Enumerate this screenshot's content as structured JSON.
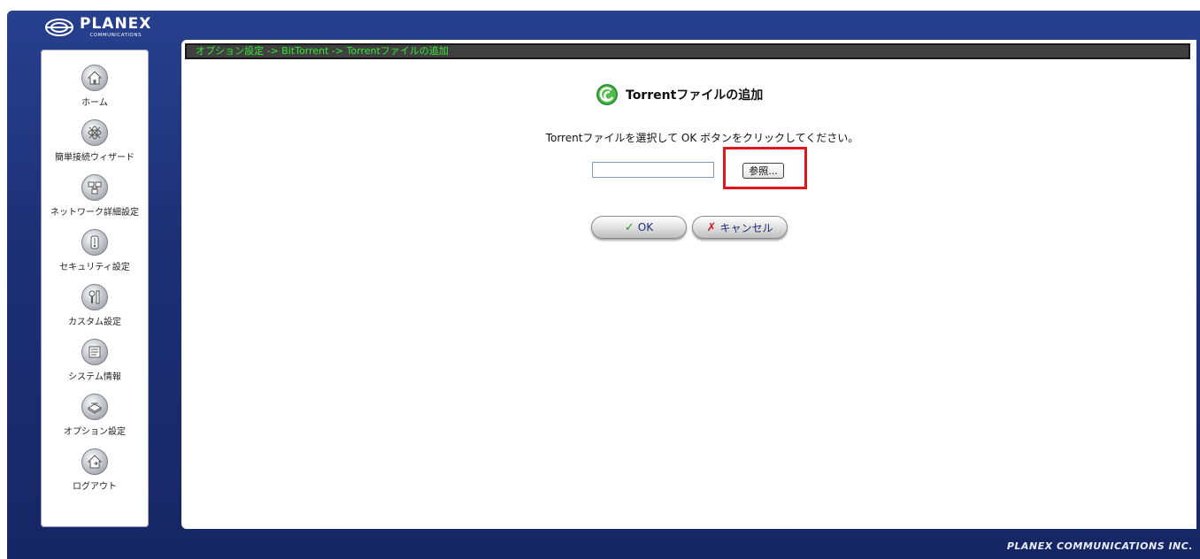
{
  "brand": {
    "name": "PLANEX",
    "subtitle": "COMMUNICATIONS",
    "footer": "PLANEX COMMUNICATIONS INC."
  },
  "sidebar": {
    "items": [
      {
        "label": "ホーム",
        "icon": "home-icon"
      },
      {
        "label": "簡単接続ウィザード",
        "icon": "wizard-icon"
      },
      {
        "label": "ネットワーク詳細設定",
        "icon": "network-icon"
      },
      {
        "label": "セキュリティ設定",
        "icon": "lock-icon"
      },
      {
        "label": "カスタム設定",
        "icon": "tools-icon"
      },
      {
        "label": "システム情報",
        "icon": "system-info-icon"
      },
      {
        "label": "オプション設定",
        "icon": "options-icon"
      },
      {
        "label": "ログアウト",
        "icon": "logout-icon"
      }
    ]
  },
  "breadcrumb": "オプション設定 -> BitTorrent -> Torrentファイルの追加",
  "main": {
    "title": "Torrentファイルの追加",
    "instruction": "Torrentファイルを選択して OK ボタンをクリックしてください。",
    "file_input_value": "",
    "browse_label": "参照...",
    "ok_label": "OK",
    "cancel_label": "キャンセル"
  },
  "colors": {
    "frame": "#1d3177",
    "breadcrumb_text": "#35e835",
    "highlight": "#e0161d"
  }
}
